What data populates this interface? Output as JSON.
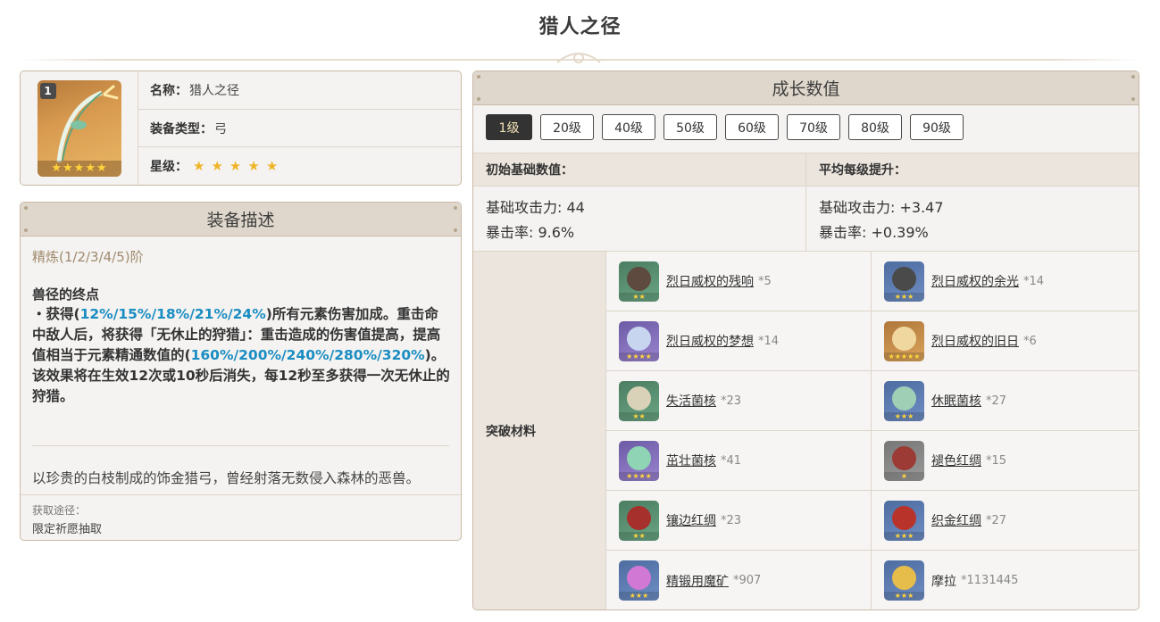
{
  "page": {
    "title": "猎人之径"
  },
  "info": {
    "level_badge": "1",
    "name_label": "名称：",
    "name_value": "猎人之径",
    "type_label": "装备类型：",
    "type_value": "弓",
    "rarity_label": "星级：",
    "rarity_stars": 5,
    "star_glyph": "★"
  },
  "description": {
    "header": "装备描述",
    "refine": "精炼(1/2/3/4/5)阶",
    "passive_name": "兽径的终点",
    "passive_segments": [
      {
        "text": "・获得(",
        "hl": false
      },
      {
        "text": "12%/15%/18%/21%/24%",
        "hl": true
      },
      {
        "text": ")所有元素伤害加成。重击命中敌人后，将获得「无休止的狩猎」：重击造成的伤害值提高，提高值相当于元素精通数值的(",
        "hl": false
      },
      {
        "text": "160%/200%/240%/280%/320%",
        "hl": true
      },
      {
        "text": ")。该效果将在生效12次或10秒后消失，每12秒至多获得一次无休止的狩猎。",
        "hl": false
      }
    ],
    "flavor": "以珍贵的白枝制成的饰金猎弓，曾经射落无数侵入森林的恶兽。",
    "source_label": "获取途径：",
    "source_value": "限定祈愿抽取"
  },
  "growth": {
    "header": "成长数值",
    "levels": [
      "1级",
      "20级",
      "40级",
      "50级",
      "60级",
      "70级",
      "80级",
      "90级"
    ],
    "active_level": "1级",
    "base_header": "初始基础数值：",
    "per_level_header": "平均每级提升：",
    "base_stats": [
      "基础攻击力: 44",
      "暴击率: 9.6%"
    ],
    "per_level_stats": [
      "基础攻击力: +3.47",
      "暴击率: +0.39%"
    ],
    "materials_label": "突破材料",
    "materials": [
      {
        "name": "烈日威权的残响",
        "count": "*5",
        "rarity": 2,
        "icon": "relic-mask-icon",
        "gem": "#5e4a3e"
      },
      {
        "name": "烈日威权的余光",
        "count": "*14",
        "rarity": 3,
        "icon": "relic-mask-icon",
        "gem": "#4a4a4a"
      },
      {
        "name": "烈日威权的梦想",
        "count": "*14",
        "rarity": 4,
        "icon": "relic-mask-icon",
        "gem": "#c7d5ef"
      },
      {
        "name": "烈日威权的旧日",
        "count": "*6",
        "rarity": 5,
        "icon": "relic-mask-icon",
        "gem": "#f0d7a0"
      },
      {
        "name": "失活菌核",
        "count": "*23",
        "rarity": 2,
        "icon": "fungal-nucleus-icon",
        "gem": "#d9d2b8"
      },
      {
        "name": "休眠菌核",
        "count": "*27",
        "rarity": 3,
        "icon": "fungal-nucleus-icon",
        "gem": "#9fd0b6"
      },
      {
        "name": "茁壮菌核",
        "count": "*41",
        "rarity": 4,
        "icon": "fungal-nucleus-icon",
        "gem": "#8fd4b5"
      },
      {
        "name": "褪色红绸",
        "count": "*15",
        "rarity": 1,
        "icon": "red-satin-icon",
        "gem": "#9c3b35"
      },
      {
        "name": "镶边红绸",
        "count": "*23",
        "rarity": 2,
        "icon": "red-satin-icon",
        "gem": "#a5302c"
      },
      {
        "name": "织金红绸",
        "count": "*27",
        "rarity": 3,
        "icon": "red-satin-icon",
        "gem": "#b8342a"
      },
      {
        "name": "精锻用魔矿",
        "count": "*907",
        "rarity": 3,
        "icon": "magic-ore-icon",
        "gem": "#d178d4"
      },
      {
        "name": "摩拉",
        "count": "*1131445",
        "rarity": 3,
        "icon": "mora-coin-icon",
        "gem": "#e6bd4a",
        "plain": true
      }
    ]
  }
}
